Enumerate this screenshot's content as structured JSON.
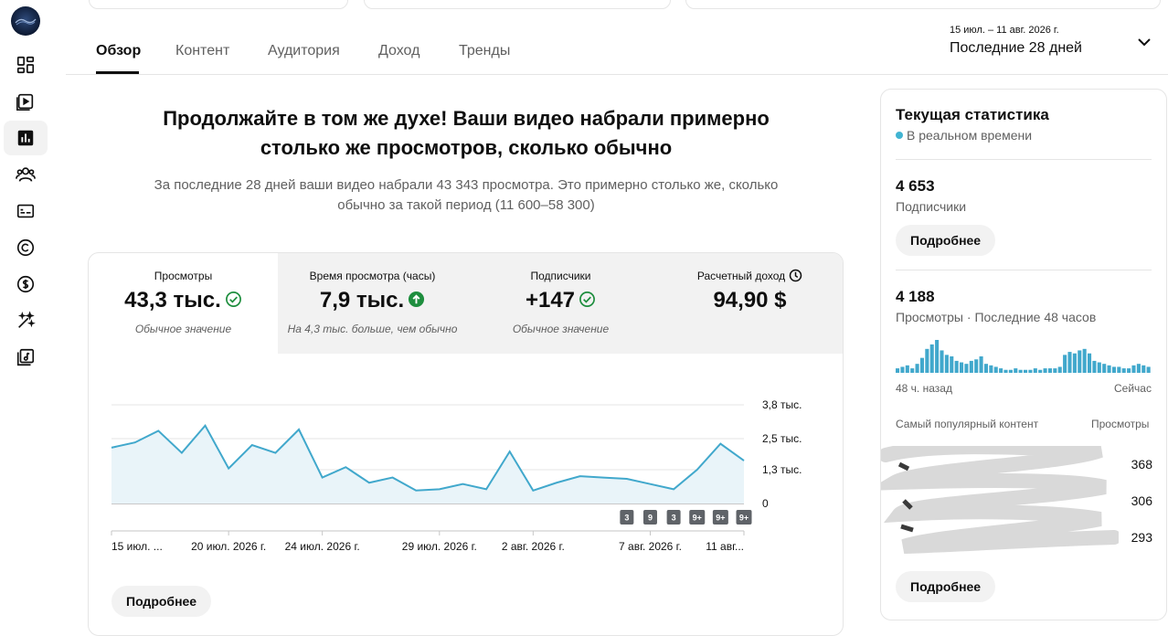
{
  "tabs": [
    {
      "label": "Обзор",
      "active": true
    },
    {
      "label": "Контент",
      "active": false
    },
    {
      "label": "Аудитория",
      "active": false
    },
    {
      "label": "Доход",
      "active": false
    },
    {
      "label": "Тренды",
      "active": false
    }
  ],
  "date_range": {
    "dates": "15 июл. – 11 авг. 2026 г.",
    "label": "Последние 28 дней"
  },
  "headline": {
    "line1": "Продолжайте в том же духе! Ваши видео набрали примерно",
    "line2": "столько же просмотров, сколько обычно",
    "sub_line1": "За последние 28 дней ваши видео набрали 43 343 просмотра. Это примерно столько же, сколько",
    "sub_line2": "обычно за такой период (11 600–58 300)"
  },
  "metrics": [
    {
      "label": "Просмотры",
      "value": "43,3 тыс.",
      "note": "Обычное значение",
      "icon": "check-circle-icon"
    },
    {
      "label": "Время просмотра (часы)",
      "value": "7,9 тыс.",
      "note": "На 4,3 тыс. больше, чем обычно",
      "icon": "arrow-up-circle-icon"
    },
    {
      "label": "Подписчики",
      "value": "+147",
      "note": "Обычное значение",
      "icon": "check-circle-icon"
    },
    {
      "label": "Расчетный доход",
      "value": "94,90 $",
      "note": "",
      "icon": "clock-icon"
    }
  ],
  "chart_data": {
    "type": "area",
    "x": [
      "15 июл.",
      "16 июл.",
      "17 июл.",
      "18 июл.",
      "19 июл.",
      "20 июл.",
      "21 июл.",
      "22 июл.",
      "23 июл.",
      "24 июл.",
      "25 июл.",
      "26 июл.",
      "27 июл.",
      "28 июл.",
      "29 июл.",
      "30 июл.",
      "31 июл.",
      "1 авг.",
      "2 авг.",
      "3 авг.",
      "4 авг.",
      "5 авг.",
      "6 авг.",
      "7 авг.",
      "8 авг.",
      "9 авг.",
      "10 авг.",
      "11 авг."
    ],
    "values": [
      2150,
      2350,
      2800,
      1950,
      3000,
      1350,
      2250,
      1950,
      2850,
      1000,
      1400,
      800,
      1000,
      500,
      550,
      750,
      550,
      2000,
      500,
      800,
      1050,
      1000,
      950,
      750,
      550,
      1300,
      2300,
      1650
    ],
    "y_ticks": [
      "3,8 тыс.",
      "2,5 тыс.",
      "1,3 тыс.",
      "0"
    ],
    "y_tick_values": [
      3800,
      2500,
      1300,
      0
    ],
    "ylim": [
      0,
      3800
    ],
    "x_tick_labels": [
      {
        "label": "15 июл. ...",
        "index": 0
      },
      {
        "label": "20 июл. 2026 г.",
        "index": 5
      },
      {
        "label": "24 июл. 2026 г.",
        "index": 9
      },
      {
        "label": "29 июл. 2026 г.",
        "index": 14
      },
      {
        "label": "2 авг. 2026 г.",
        "index": 18
      },
      {
        "label": "7 авг. 2026 г.",
        "index": 23
      },
      {
        "label": "11 авг...",
        "index": 27
      }
    ],
    "markers": [
      {
        "label": "3",
        "index": 22
      },
      {
        "label": "9",
        "index": 23
      },
      {
        "label": "3",
        "index": 24
      },
      {
        "label": "9+",
        "index": 25
      },
      {
        "label": "9+",
        "index": 26
      },
      {
        "label": "9+",
        "index": 27
      }
    ],
    "color": "#41a8cc",
    "fill": "#e9f4f9",
    "grid": true
  },
  "more_button": "Подробнее",
  "realtime": {
    "title": "Текущая статистика",
    "live_label": "В реальном времени",
    "subscribers_value": "4 653",
    "subscribers_label": "Подписчики",
    "more_button_1": "Подробнее",
    "views_value": "4 188",
    "views_label": "Просмотры · Последние 48 часов",
    "bars": [
      3,
      4,
      5,
      3,
      6,
      10,
      16,
      19,
      22,
      15,
      12,
      11,
      8,
      7,
      6,
      8,
      9,
      11,
      6,
      5,
      4,
      3,
      2,
      2,
      3,
      2,
      2,
      2,
      3,
      2,
      3,
      3,
      3,
      4,
      12,
      14,
      13,
      15,
      16,
      13,
      8,
      7,
      6,
      5,
      4,
      4,
      3,
      3,
      5,
      6,
      5,
      4
    ],
    "bar_axis_left": "48 ч. назад",
    "bar_axis_right": "Сейчас",
    "top_content_label": "Самый популярный контент",
    "top_content_views_label": "Просмотры",
    "top_counts": [
      "368",
      "306",
      "293"
    ],
    "more_button_2": "Подробнее"
  },
  "colors": {
    "accent": "#41a8cc",
    "check_green": "#1e8e3e",
    "up_green": "#1e8e3e",
    "marker_bg": "#5f6368"
  }
}
